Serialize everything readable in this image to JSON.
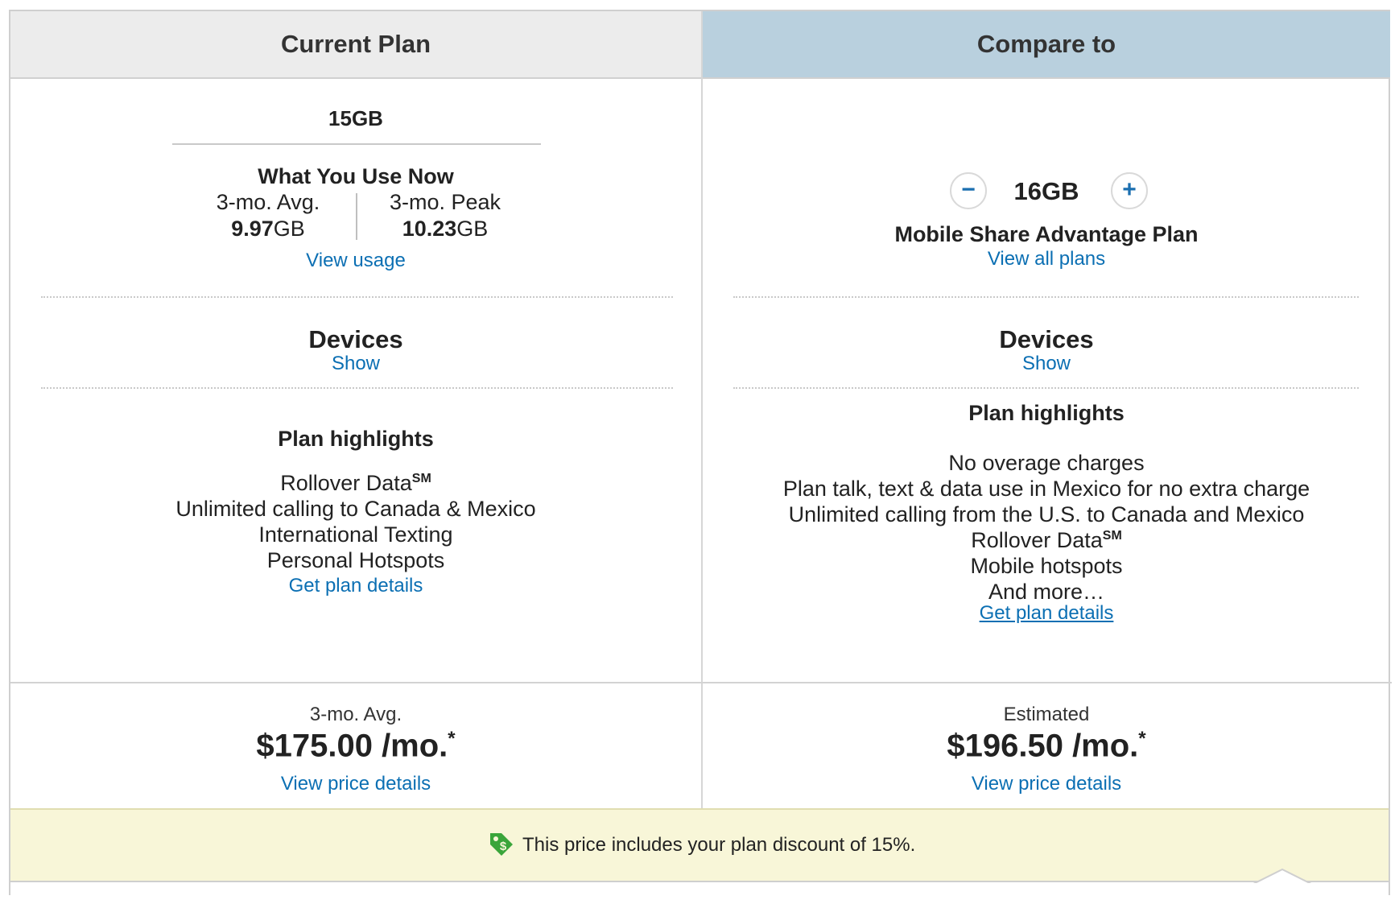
{
  "current": {
    "header": "Current Plan",
    "plan_size": "15GB",
    "usage_title": "What You Use Now",
    "avg_label": "3-mo. Avg.",
    "avg_value": "9.97",
    "avg_unit": "GB",
    "peak_label": "3-mo. Peak",
    "peak_value": "10.23",
    "peak_unit": "GB",
    "view_usage": "View usage",
    "devices_title": "Devices",
    "devices_show": "Show",
    "highlights_title": "Plan highlights",
    "highlights": [
      "Rollover Data",
      "Unlimited calling to Canada & Mexico",
      "International Texting",
      "Personal Hotspots"
    ],
    "rollover_mark": "SM",
    "plan_details": "Get plan details",
    "price_label": "3-mo. Avg.",
    "price": "$175.00 /mo.",
    "price_asterisk": "*",
    "price_details": "View price details"
  },
  "compare": {
    "header": "Compare to",
    "minus": "−",
    "plus": "+",
    "plan_size": "16GB",
    "plan_name": "Mobile Share Advantage Plan",
    "view_all": "View all plans",
    "devices_title": "Devices",
    "devices_show": "Show",
    "highlights_title": "Plan highlights",
    "highlights": [
      "No overage charges",
      "Plan talk, text & data use in Mexico for no extra charge",
      "Unlimited calling from the U.S. to Canada and Mexico",
      "Rollover Data",
      "Mobile hotspots",
      "And more…"
    ],
    "rollover_mark": "SM",
    "plan_details": "Get plan details",
    "price_label": "Estimated",
    "price": "$196.50 /mo.",
    "price_asterisk": "*",
    "price_details": "View price details"
  },
  "banner": {
    "text": "This price includes your plan discount of 15%.",
    "icon": "discount-tag-icon",
    "color": "#3aa53a"
  }
}
